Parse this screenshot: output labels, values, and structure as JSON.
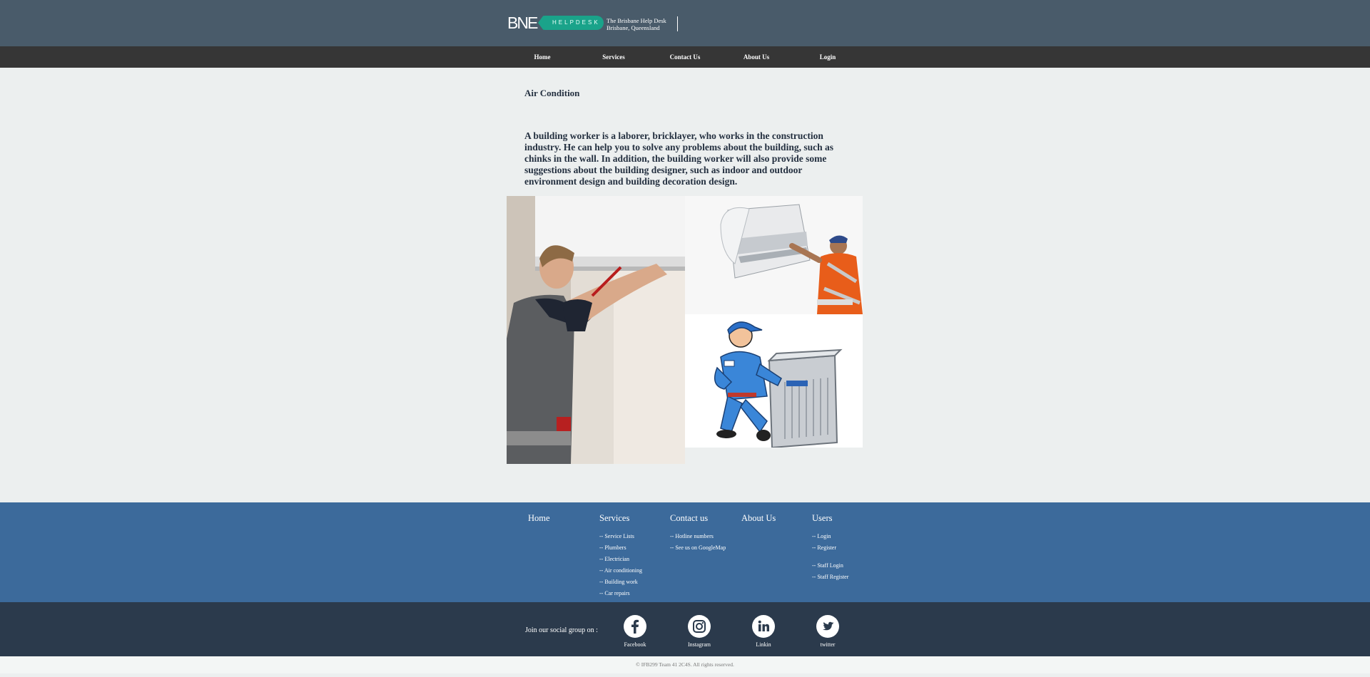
{
  "header": {
    "logo_text": "BNE",
    "logo_pill_text": "HELPDESK",
    "tagline_line1": "The Brisbane Help Desk",
    "tagline_line2": "Brisbane, Queensland",
    "bg_color": "#495b6a",
    "accent_color": "#1aa38a"
  },
  "nav": {
    "items": [
      {
        "label": "Home"
      },
      {
        "label": "Services"
      },
      {
        "label": "Contact Us"
      },
      {
        "label": "About Us"
      },
      {
        "label": "Login"
      }
    ]
  },
  "main": {
    "heading": "Air Condition",
    "description": "A building worker is a laborer, bricklayer, who works in the construction industry. He can help you to solve any problems about the building, such as chinks in the wall. In addition, the building worker will also provide some suggestions about the building designer, such as indoor and outdoor environment design and building decoration design."
  },
  "footer": {
    "columns": [
      {
        "title": "Home",
        "links": []
      },
      {
        "title": "Services",
        "links": [
          "-- Service Lists",
          "-- Plumbers",
          "-- Electrician",
          "-- Air conditioning",
          "-- Building work",
          "-- Car repairs"
        ]
      },
      {
        "title": "Contact us",
        "links": [
          "-- Hotline numbers",
          "-- See us on GoogleMap"
        ]
      },
      {
        "title": "About Us",
        "links": []
      },
      {
        "title": "Users",
        "links": [
          "-- Login",
          "-- Register",
          "-- Staff Login",
          "-- Staff Register"
        ]
      }
    ],
    "bg_color": "#3c6a9b"
  },
  "social": {
    "label": "Join our social group on :",
    "items": [
      {
        "label": "Facebook",
        "icon": "facebook-icon"
      },
      {
        "label": "Instagram",
        "icon": "instagram-icon"
      },
      {
        "label": "Linkin",
        "icon": "linkedin-icon"
      },
      {
        "label": "twitter",
        "icon": "twitter-icon"
      }
    ]
  },
  "copyright": "© IFB299 Team 41 2C4S. All rights reserved."
}
